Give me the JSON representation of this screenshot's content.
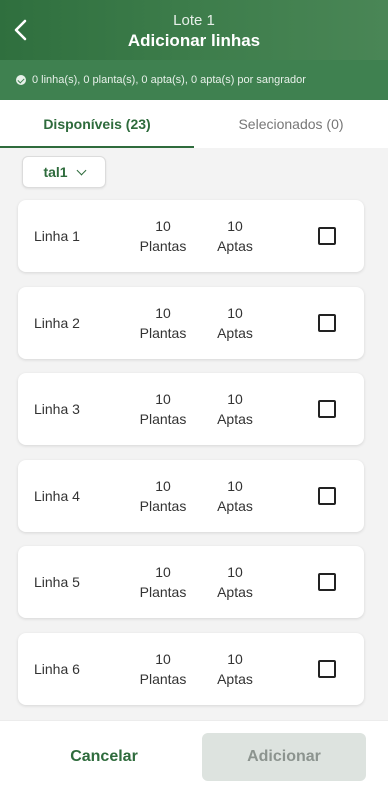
{
  "header": {
    "lot": "Lote 1",
    "title": "Adicionar linhas"
  },
  "summary": {
    "text": "0 linha(s), 0 planta(s), 0 apta(s), 0 apta(s) por sangrador"
  },
  "tabs": [
    {
      "label": "Disponíveis (23)",
      "active": true
    },
    {
      "label": "Selecionados (0)",
      "active": false
    }
  ],
  "filter": {
    "value": "tal1"
  },
  "rows": [
    {
      "name": "Linha 1",
      "plantas_count": "10",
      "plantas_label": "Plantas",
      "aptas_count": "10",
      "aptas_label": "Aptas"
    },
    {
      "name": "Linha 2",
      "plantas_count": "10",
      "plantas_label": "Plantas",
      "aptas_count": "10",
      "aptas_label": "Aptas"
    },
    {
      "name": "Linha 3",
      "plantas_count": "10",
      "plantas_label": "Plantas",
      "aptas_count": "10",
      "aptas_label": "Aptas"
    },
    {
      "name": "Linha 4",
      "plantas_count": "10",
      "plantas_label": "Plantas",
      "aptas_count": "10",
      "aptas_label": "Aptas"
    },
    {
      "name": "Linha 5",
      "plantas_count": "10",
      "plantas_label": "Plantas",
      "aptas_count": "10",
      "aptas_label": "Aptas"
    },
    {
      "name": "Linha 6",
      "plantas_count": "10",
      "plantas_label": "Plantas",
      "aptas_count": "10",
      "aptas_label": "Aptas"
    }
  ],
  "footer": {
    "cancel_label": "Cancelar",
    "add_label": "Adicionar"
  },
  "colors": {
    "primary": "#2e6b3c",
    "summary_bg": "#3f8150",
    "disabled_bg": "#dde3df"
  }
}
